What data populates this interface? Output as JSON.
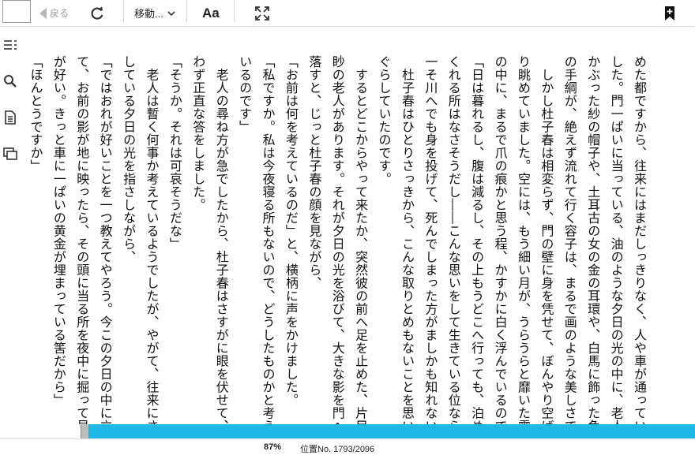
{
  "toolbar": {
    "back_label": "戻る",
    "move_label": "移動...",
    "font_label": "Aa",
    "icons": [
      "refresh-icon",
      "chevron-down-icon",
      "fullscreen-icon",
      "bookmark-icon"
    ]
  },
  "sidebar": {
    "icons": [
      "toc-icon",
      "search-icon",
      "notes-icon",
      "pages-icon"
    ]
  },
  "content": {
    "lines": [
      "めた都ですから、往来にはまだしっきりなく、人や車が通っていま",
      "した。門一ぱいに当っている、油のような夕日の光の中に、老人の",
      "かぶった紗の帽子や、土耳古の女の金の耳環や、白馬に飾った色糸",
      "の手綱が、絶えず流れて行く容子は、まるで画のような美しさです。",
      "　しかし杜子春は相変らず、門の壁に身を凭せて、ぼんやり空ばか",
      "り眺めていました。空には、もう細い月が、うらうらと靡いた霞",
      "の中に、まるで爪の痕かと思う程、かすかに白く浮んでいるのです。",
      "「日は暮れるし、腹は減るし、その上もうどこへ行っても、泊めて",
      "くれる所はなさそうだし――こんな思いをして生きている位なら、",
      "一そ川へでも身を投げて、死んでしまった方がましかも知れない」",
      "　杜子春はひとりさっきから、こんな取りとめもないことを思いめ",
      "ぐらしていたのです。",
      "　するとどこからやって来たか、突然彼の前へ足を止めた、片目",
      "眇の老人があります。それが夕日の光を浴びて、大きな影を門へ",
      "落すと、じっと杜子春の顔を見ながら、",
      "「お前は何を考えているのだ」と、横柄に声をかけました。",
      "「私ですか。私は今夜寝る所もないので、どうしたものかと考えて",
      "いるのです」",
      "　老人の尋ね方が急でしたから、杜子春はさすがに眼を伏せて、思",
      "わず正直な答をしました。",
      "「そうか。それは可哀そうだな」",
      "　老人は暫く何事か考えているようでしたが、やがて、往来にさ",
      "している夕日の光を指さしながら、",
      "「ではおれが好いことを一つ教えてやろう。今この夕日の中に立っ",
      "て、お前の影が地に映ったら、その頭に当る所を夜中に掘って見る",
      "が好い。きっと車に一ぱいの黄金が埋まっている筈だから」",
      "「ほんとうですか」"
    ]
  },
  "status": {
    "percent": "87%",
    "location": "位置No. 1793/2096",
    "progress": 0.87
  },
  "colors": {
    "progress_bar": "#1fb8e6"
  }
}
